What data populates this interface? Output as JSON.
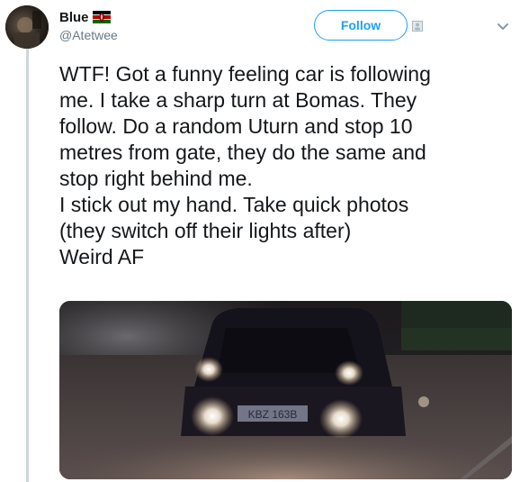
{
  "tweet": {
    "author": {
      "display_name": "Blue",
      "handle": "@Atetwee",
      "flag_icon": "kenya-flag-icon"
    },
    "follow_label": "Follow",
    "text_lines": [
      "WTF! Got a funny feeling car is following",
      "me. I take a sharp turn at Bomas. They",
      "follow. Do a random Uturn and stop 10",
      "metres from gate, they do the same and",
      "stop right behind me.",
      "I stick out my hand. Take quick photos",
      "(they switch off their lights after)",
      "Weird AF"
    ],
    "media": {
      "plate_text": "KBZ 163B"
    }
  },
  "colors": {
    "accent": "#1da1f2",
    "text": "#14171a",
    "secondary_text": "#657786",
    "thread_line": "#ccd6dd"
  }
}
